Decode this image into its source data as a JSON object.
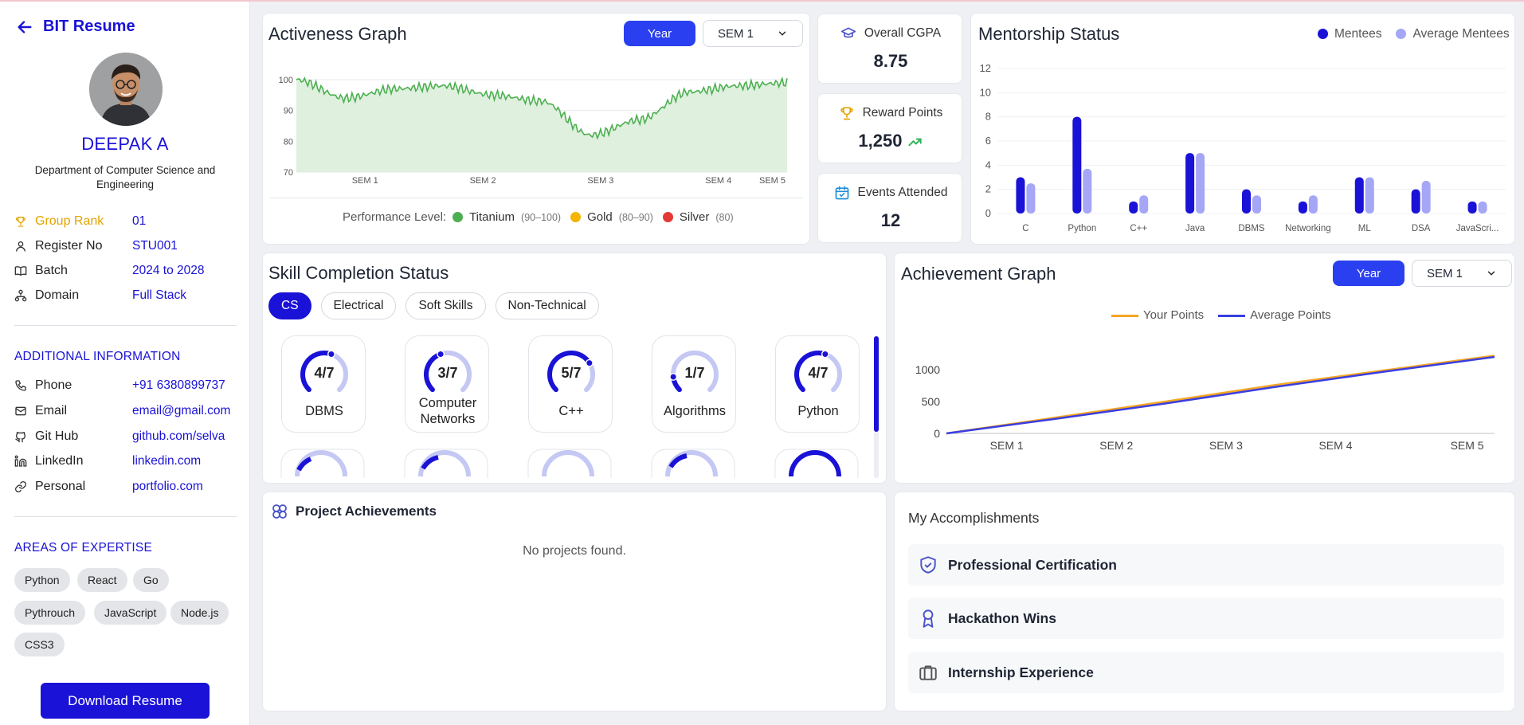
{
  "app": {
    "title": "BIT Resume"
  },
  "profile": {
    "name": "DEEPAK A",
    "department": "Department of Computer Science and Engineering",
    "info": [
      {
        "label": "Group Rank",
        "value": "01",
        "icon": "trophy-icon"
      },
      {
        "label": "Register No",
        "value": "STU001",
        "icon": "user-icon"
      },
      {
        "label": "Batch",
        "value": "2024 to 2028",
        "icon": "book-icon"
      },
      {
        "label": "Domain",
        "value": "Full Stack",
        "icon": "network-icon"
      }
    ]
  },
  "additional": {
    "heading": "ADDITIONAL INFORMATION",
    "items": [
      {
        "label": "Phone",
        "value": "+91 6380899737",
        "icon": "phone-icon"
      },
      {
        "label": "Email",
        "value": "email@gmail.com",
        "icon": "mail-icon"
      },
      {
        "label": "Git Hub",
        "value": "github.com/selva",
        "icon": "git-icon"
      },
      {
        "label": "LinkedIn",
        "value": "linkedin.com",
        "icon": "linkedin-icon"
      },
      {
        "label": "Personal",
        "value": "portfolio.com",
        "icon": "link-icon"
      }
    ]
  },
  "expertise": {
    "heading": "AREAS OF EXPERTISE",
    "chips": [
      "Python",
      "React",
      "Go",
      "Pythrouch",
      "JavaScript",
      "Node.js",
      "CSS3"
    ]
  },
  "download_label": "Download Resume",
  "activeness": {
    "title": "Activeness Graph",
    "year_label": "Year",
    "sem_select": "SEM 1",
    "y_ticks": [
      "100",
      "90",
      "80",
      "70"
    ],
    "x_ticks": [
      "SEM 1",
      "SEM 2",
      "SEM 3",
      "SEM 4",
      "SEM 5"
    ],
    "legend_label": "Performance Level:",
    "levels": [
      {
        "name": "Titanium",
        "range": "(90–100)",
        "color": "#4caf50"
      },
      {
        "name": "Gold",
        "range": "(80–90)",
        "color": "#f5b400"
      },
      {
        "name": "Silver",
        "range": "(80)",
        "color": "#e53935"
      }
    ]
  },
  "stats": {
    "cgpa_label": "Overall CGPA",
    "cgpa_value": "8.75",
    "reward_label": "Reward Points",
    "reward_value": "1,250",
    "events_label": "Events Attended",
    "events_value": "12"
  },
  "mentorship": {
    "title": "Mentorship Status",
    "legend": [
      "Mentees",
      "Average Mentees"
    ]
  },
  "skills": {
    "title": "Skill Completion Status",
    "tabs": [
      "CS",
      "Electrical",
      "Soft Skills",
      "Non-Technical"
    ],
    "items": [
      {
        "fraction": "4/7",
        "name": "DBMS",
        "value": 0.571
      },
      {
        "fraction": "3/7",
        "name": "Computer Networks",
        "value": 0.429
      },
      {
        "fraction": "5/7",
        "name": "C++",
        "value": 0.714
      },
      {
        "fraction": "1/7",
        "name": "Algorithms",
        "value": 0.143
      },
      {
        "fraction": "4/7",
        "name": "Python",
        "value": 0.571
      }
    ]
  },
  "achievement": {
    "title": "Achievement Graph",
    "year_label": "Year",
    "sem_select": "SEM 1",
    "legend": [
      "Your Points",
      "Average Points"
    ]
  },
  "projects": {
    "title": "Project Achievements",
    "empty": "No projects found."
  },
  "accomplishments": {
    "title": "My Accomplishments",
    "items": [
      "Professional Certification",
      "Hackathon Wins",
      "Internship Experience"
    ]
  },
  "chart_data": [
    {
      "type": "area",
      "title": "Activeness Graph",
      "x_ticks": [
        "SEM 1",
        "SEM 2",
        "SEM 3",
        "SEM 4",
        "SEM 5"
      ],
      "x": [
        0,
        0.5,
        1,
        1.5,
        2,
        2.5,
        3,
        3.5,
        4,
        4.5,
        5
      ],
      "values": [
        100,
        94,
        97,
        98,
        95,
        93,
        82,
        87,
        96,
        98,
        99
      ],
      "ylim": [
        70,
        100
      ],
      "y_ticks": [
        70,
        80,
        90,
        100
      ],
      "fill": "#dff0df",
      "stroke": "#4caf50"
    },
    {
      "type": "bar",
      "title": "Mentorship Status",
      "categories": [
        "C",
        "Python",
        "C++",
        "Java",
        "DBMS",
        "Networking",
        "ML",
        "DSA",
        "JavaScri..."
      ],
      "series": [
        {
          "name": "Mentees",
          "values": [
            3,
            8,
            1,
            5,
            2,
            1,
            3,
            2,
            1
          ],
          "color": "#1a12d6"
        },
        {
          "name": "Average Mentees",
          "values": [
            2.5,
            3.7,
            1.5,
            5,
            1.5,
            1.5,
            3,
            2.7,
            1
          ],
          "color": "#a5a6f6"
        }
      ],
      "ylim": [
        0,
        12
      ],
      "y_ticks": [
        0,
        2,
        4,
        6,
        8,
        10,
        12
      ],
      "legend": "top-right"
    },
    {
      "type": "line",
      "title": "Achievement Graph",
      "x_ticks": [
        "SEM 1",
        "SEM 2",
        "SEM 3",
        "SEM 4",
        "SEM 5"
      ],
      "x": [
        0,
        1,
        2,
        3,
        4,
        5
      ],
      "series": [
        {
          "name": "Your Points",
          "values": [
            0,
            250,
            500,
            760,
            990,
            1220
          ],
          "color": "#f5a623"
        },
        {
          "name": "Average Points",
          "values": [
            0,
            230,
            470,
            730,
            970,
            1200
          ],
          "color": "#3a3ee0"
        }
      ],
      "ylim": [
        0,
        1300
      ],
      "y_ticks": [
        0,
        500,
        1000
      ],
      "legend": "top"
    }
  ]
}
